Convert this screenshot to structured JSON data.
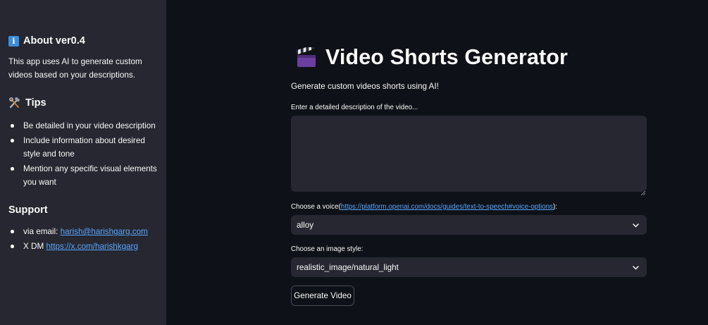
{
  "sidebar": {
    "about": {
      "icon": "info-icon",
      "heading": "About ver0.4",
      "text": "This app uses AI to generate custom videos based on your descriptions."
    },
    "tips": {
      "icon": "hammer-wrench-icon",
      "heading": "Tips",
      "items": [
        "Be detailed in your video description",
        "Include information about desired style and tone",
        "Mention any specific visual elements you want"
      ]
    },
    "support": {
      "heading": "Support",
      "email_prefix": "via email: ",
      "email": "harish@harishgarg.com",
      "dm_prefix": "X DM ",
      "dm_link": "https://x.com/harishkgarg"
    }
  },
  "main": {
    "title_icon": "clapper-board-icon",
    "title": "Video Shorts Generator",
    "subtitle": "Generate custom videos shorts using AI!",
    "description": {
      "label": "Enter a detailed description of the video...",
      "value": ""
    },
    "voice": {
      "label_prefix": "Choose a voice(",
      "label_link": "https://platform.openai.com/docs/guides/text-to-speech#voice-options",
      "label_suffix": "):",
      "selected": "alloy"
    },
    "image_style": {
      "label": "Choose an image style:",
      "selected": "realistic_image/natural_light"
    },
    "generate_button": "Generate Video"
  },
  "colors": {
    "background": "#0e1117",
    "sidebar": "#262730",
    "input": "#262730",
    "link": "#5aa7ff",
    "text": "#fafafa"
  }
}
